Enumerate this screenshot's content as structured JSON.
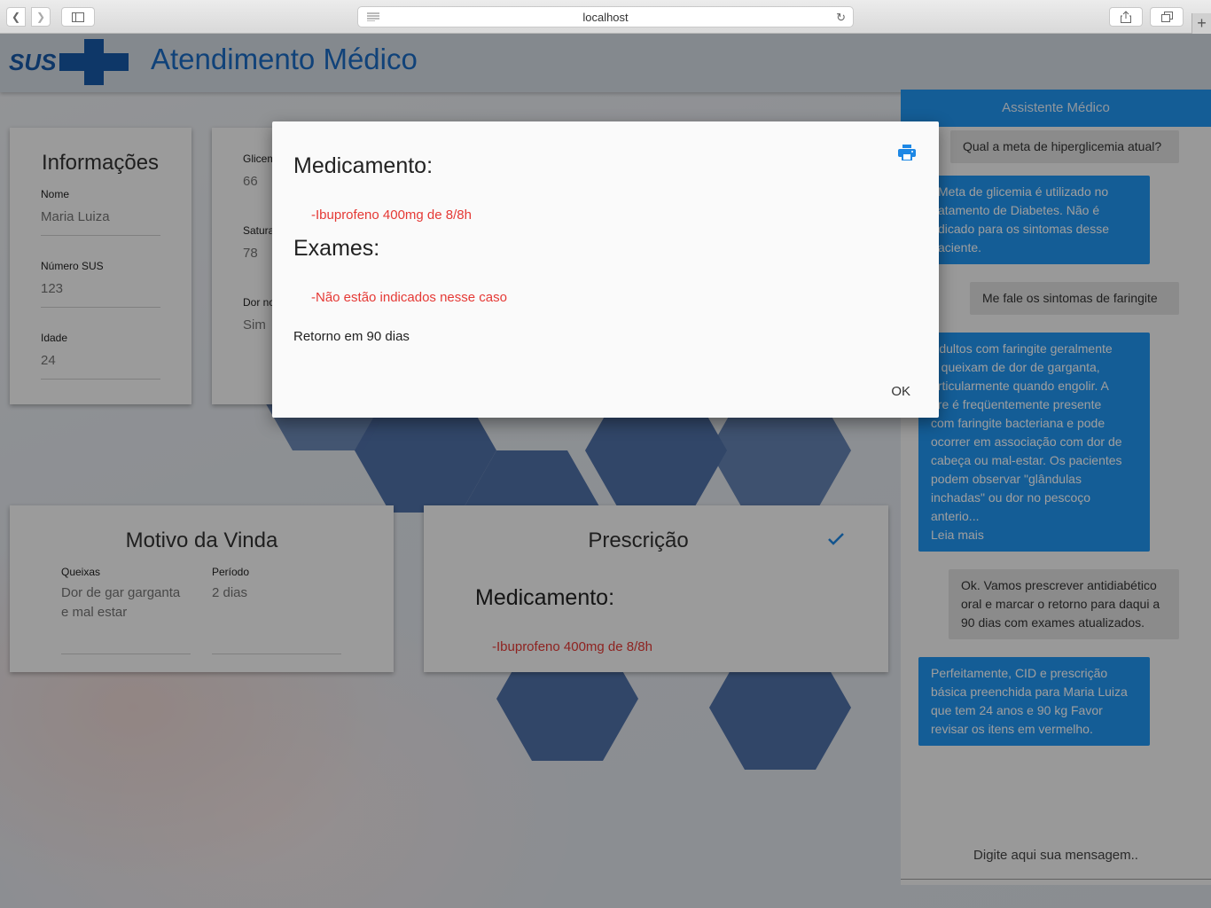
{
  "browser": {
    "url": "localhost"
  },
  "header": {
    "logo_text": "SUS",
    "title": "Atendimento Médico"
  },
  "info": {
    "title": "Informações",
    "fields": [
      {
        "label": "Nome",
        "value": "Maria Luiza"
      },
      {
        "label": "Número SUS",
        "value": "123"
      },
      {
        "label": "Idade",
        "value": "24"
      }
    ]
  },
  "vitals": {
    "fields": [
      {
        "label": "Glicem",
        "value": "66"
      },
      {
        "label": "Satura",
        "value": "78"
      },
      {
        "label": "Dor no",
        "value": "Sim"
      }
    ]
  },
  "motivo": {
    "title": "Motivo da Vinda",
    "queixas_label": "Queixas",
    "queixas_value": "Dor de gar garganta e mal estar",
    "periodo_label": "Período",
    "periodo_value": "2 dias"
  },
  "prescricao": {
    "title": "Prescrição",
    "med_heading": "Medicamento:",
    "med_item": "-Ibuprofeno 400mg de 8/8h"
  },
  "chat": {
    "title": "Assistente Médico",
    "messages": [
      {
        "from": "user",
        "text": "Qual a meta de hiperglicemia atual?"
      },
      {
        "from": "bot",
        "text": "Meta de glicemia é utilizado no\natamento de Diabetes. Não é\ndicado para os sintomas desse\naciente."
      },
      {
        "from": "user",
        "text": "Me fale os sintomas de faringite"
      },
      {
        "from": "bot",
        "text": "Adultos com faringite geralmente\ne queixam de dor de garganta,\narticularmente quando engolir. A\nbre é freqüentemente presente\ncom faringite bacteriana e pode\nocorrer em associação com dor de\ncabeça ou mal-estar. Os pacientes\npodem observar \"glândulas\ninchadas\" ou dor no pescoço\nanterio...\nLeia mais"
      },
      {
        "from": "user",
        "text": "Ok. Vamos prescrever antidiabético\noral e marcar o retorno para daqui a\n90 dias com exames atualizados."
      },
      {
        "from": "bot",
        "text": "  Perfeitamente, CID e prescrição\nbásica preenchida para Maria Luiza\nque tem 24 anos e 90 kg  Favor\nrevisar os itens em vermelho."
      }
    ],
    "input_placeholder": "Digite aqui sua mensagem.."
  },
  "modal": {
    "med_heading": "Medicamento:",
    "med_item": "-Ibuprofeno 400mg de 8/8h",
    "exam_heading": "Exames:",
    "exam_item": "-Não estão indicados nesse caso",
    "retorno": "Retorno em 90 dias",
    "ok_label": "OK"
  },
  "colors": {
    "primary": "#2196f3",
    "brand": "#1859a8",
    "alert": "#e53935"
  }
}
